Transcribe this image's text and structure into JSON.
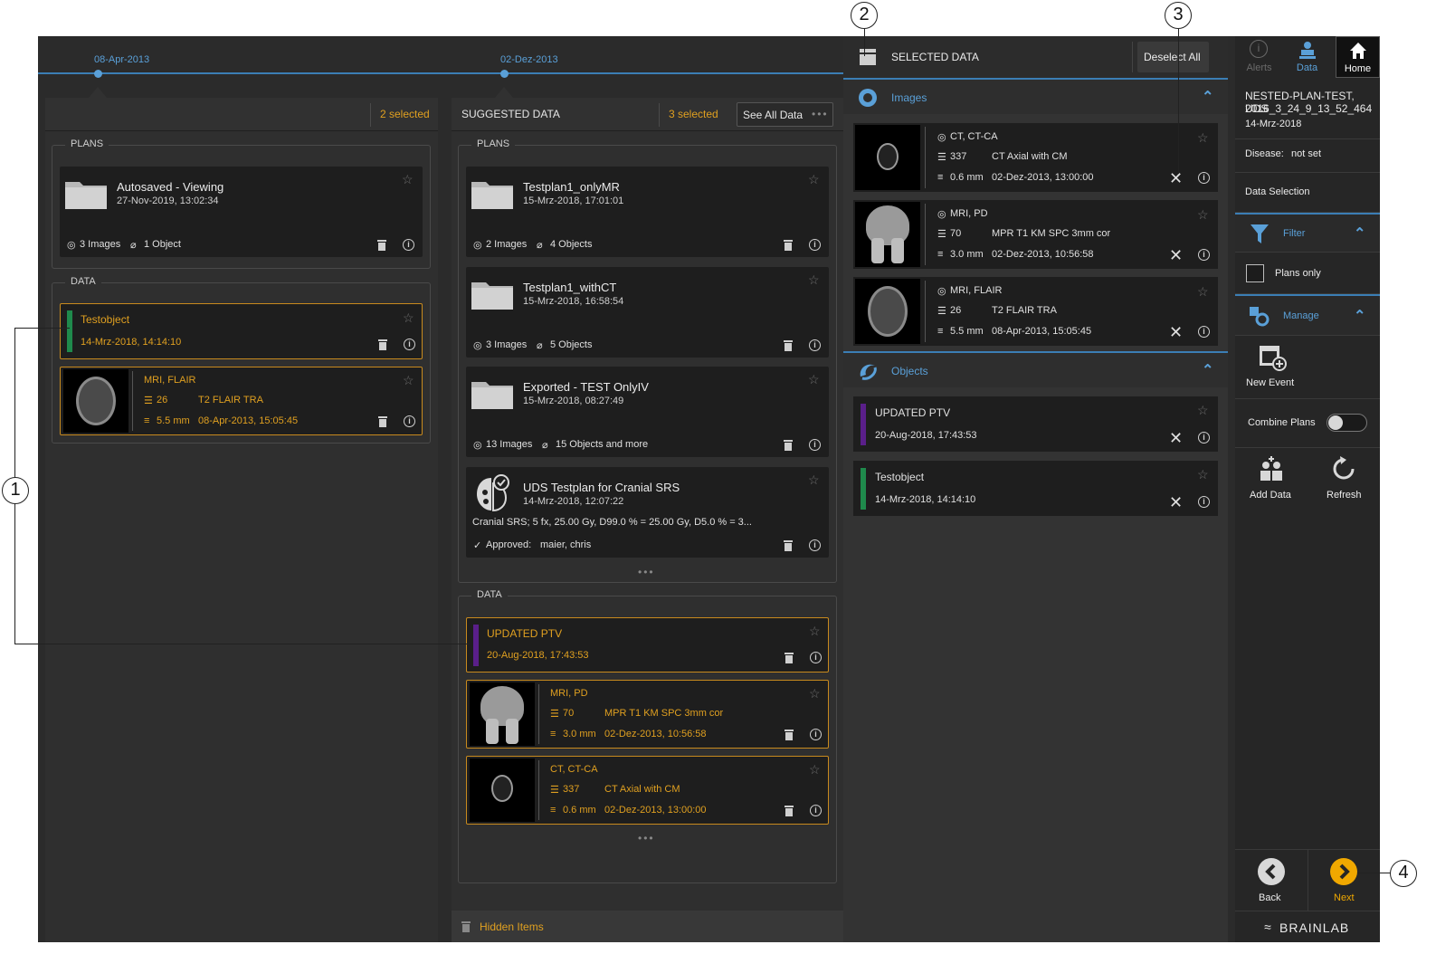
{
  "timeline": {
    "dates": [
      "08-Apr-2013",
      "02-Dez-2013"
    ]
  },
  "left_column": {
    "selected_count": "2 selected",
    "plans_label": "PLANS",
    "data_label": "DATA",
    "plan": {
      "title": "Autosaved - Viewing",
      "date": "27-Nov-2019, 13:02:34",
      "images": "3 Images",
      "objects": "1 Object"
    },
    "object": {
      "name": "Testobject",
      "date": "14-Mrz-2018, 14:14:10"
    },
    "image": {
      "modality": "MRI, FLAIR",
      "count": "26",
      "series": "T2 FLAIR TRA",
      "thickness": "5.5 mm",
      "date": "08-Apr-2013, 15:05:45"
    }
  },
  "suggested_column": {
    "title": "SUGGESTED DATA",
    "selected_count": "3 selected",
    "see_all": "See All Data",
    "plans_label": "PLANS",
    "data_label": "DATA",
    "plans": [
      {
        "title": "Testplan1_onlyMR",
        "date": "15-Mrz-2018, 17:01:01",
        "images": "2 Images",
        "objects": "4 Objects"
      },
      {
        "title": "Testplan1_withCT",
        "date": "15-Mrz-2018, 16:58:54",
        "images": "3 Images",
        "objects": "5 Objects"
      },
      {
        "title": "Exported - TEST OnlyIV",
        "date": "15-Mrz-2018, 08:27:49",
        "images": "13 Images",
        "objects": "15 Objects and more"
      }
    ],
    "srs_plan": {
      "title": "UDS Testplan for Cranial SRS",
      "date": "14-Mrz-2018, 12:07:22",
      "desc": "Cranial SRS; 5 fx, 25.00 Gy, D99.0 % = 25.00 Gy, D5.0 % = 3...",
      "approved_label": "Approved:",
      "approved_by": "maier, chris"
    },
    "object": {
      "name": "UPDATED PTV",
      "date": "20-Aug-2018, 17:43:53"
    },
    "images": [
      {
        "modality": "MRI, PD",
        "count": "70",
        "series": "MPR T1 KM SPC 3mm cor",
        "thickness": "3.0 mm",
        "date": "02-Dez-2013, 10:56:58"
      },
      {
        "modality": "CT, CT-CA",
        "count": "337",
        "series": "CT Axial with CM",
        "thickness": "0.6 mm",
        "date": "02-Dez-2013, 13:00:00"
      }
    ],
    "hidden_items": "Hidden Items"
  },
  "selected_panel": {
    "title": "SELECTED DATA",
    "deselect_all": "Deselect All",
    "images_label": "Images",
    "objects_label": "Objects",
    "images": [
      {
        "modality": "CT, CT-CA",
        "count": "337",
        "series": "CT Axial with CM",
        "thickness": "0.6 mm",
        "date": "02-Dez-2013, 13:00:00"
      },
      {
        "modality": "MRI, PD",
        "count": "70",
        "series": "MPR T1 KM SPC 3mm cor",
        "thickness": "3.0 mm",
        "date": "02-Dez-2013, 10:56:58"
      },
      {
        "modality": "MRI, FLAIR",
        "count": "26",
        "series": "T2 FLAIR TRA",
        "thickness": "5.5 mm",
        "date": "08-Apr-2013, 15:05:45"
      }
    ],
    "objects": [
      {
        "name": "UPDATED PTV",
        "date": "20-Aug-2018, 17:43:53"
      },
      {
        "name": "Testobject",
        "date": "14-Mrz-2018, 14:14:10"
      }
    ]
  },
  "right_bar": {
    "tabs": {
      "alerts": "Alerts",
      "data": "Data",
      "home": "Home"
    },
    "patient_name": "NESTED-PLAN-TEST, UDS",
    "patient_id": "2016_3_24_9_13_52_464",
    "patient_date": "14-Mrz-2018",
    "disease_label": "Disease:",
    "disease_value": "not set",
    "data_selection": "Data Selection",
    "filter": "Filter",
    "plans_only": "Plans only",
    "manage": "Manage",
    "new_event": "New Event",
    "combine_plans": "Combine Plans",
    "add_data": "Add Data",
    "refresh": "Refresh",
    "back": "Back",
    "next": "Next",
    "brand": "BRAINLAB"
  },
  "callouts": [
    "1",
    "2",
    "3",
    "4"
  ],
  "colors": {
    "accent_orange": "#e0a020",
    "accent_blue": "#5aa0d8",
    "object_green": "#1f8a4c",
    "object_purple": "#5a1f8a"
  }
}
